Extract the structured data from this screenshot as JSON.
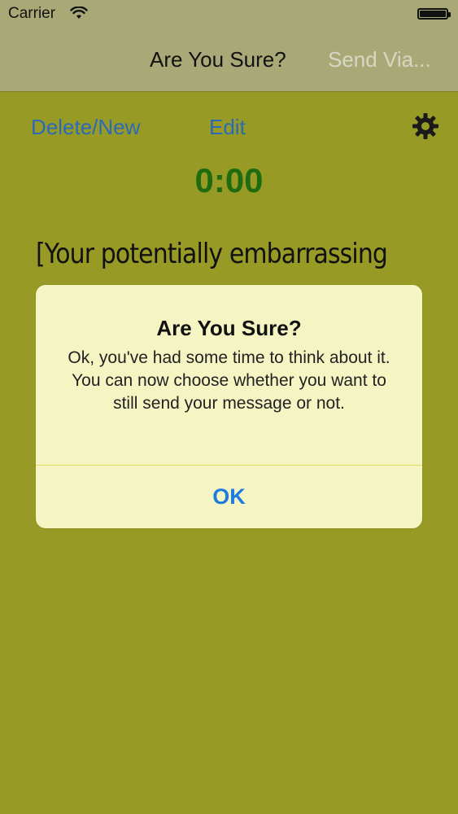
{
  "status_bar": {
    "carrier": "Carrier",
    "wifi_icon": "wifi-icon",
    "battery_icon": "battery-icon"
  },
  "nav_bar": {
    "title": "Are You Sure?",
    "send_label": "Send Via..."
  },
  "toolbar": {
    "delete_new_label": "Delete/New",
    "edit_label": "Edit",
    "settings_icon": "gear-icon"
  },
  "timer": "0:00",
  "message_preview": "[Your potentially embarrassing",
  "alert": {
    "title": "Are You Sure?",
    "message": "Ok, you've had some time to think about it.  You can now choose whether you want to still send your message or not.",
    "ok_label": "OK"
  },
  "colors": {
    "background": "#979a25",
    "bar": "#a9a978",
    "link_blue": "#2a6ab8",
    "timer_green": "#1f6b10",
    "alert_bg": "#f5f4c3",
    "alert_button": "#1c7ce0"
  }
}
